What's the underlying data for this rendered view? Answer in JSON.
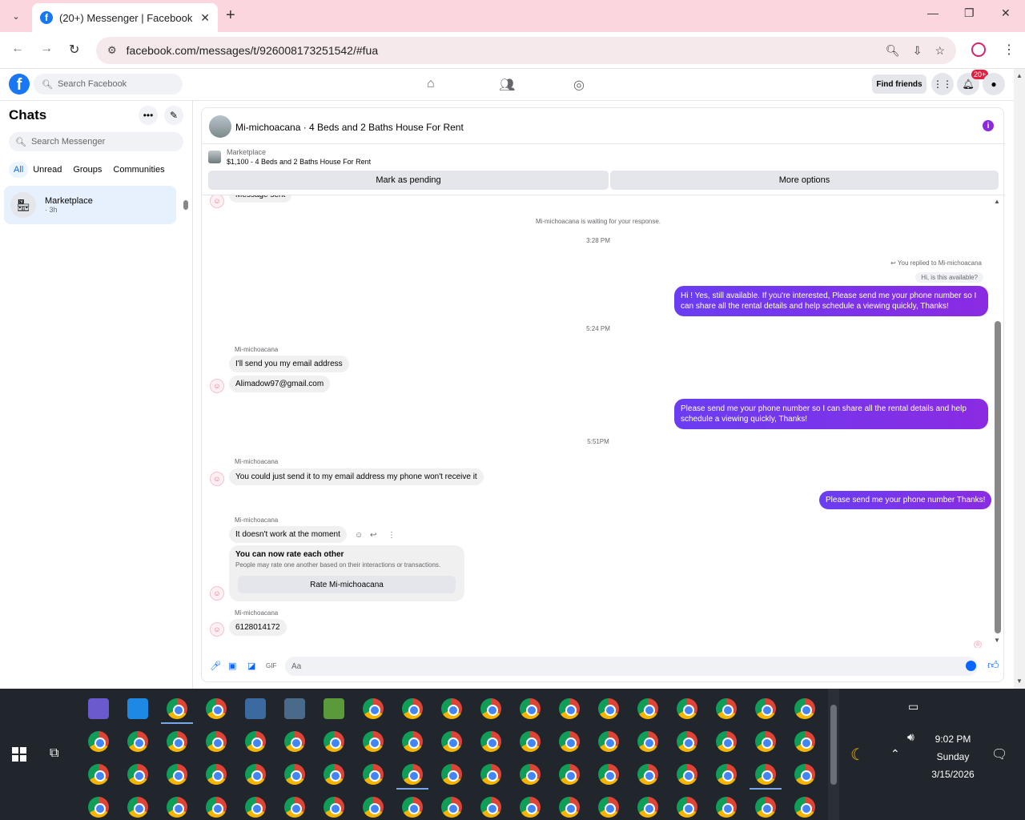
{
  "browser": {
    "tab_title": "(20+) Messenger | Facebook",
    "url": "facebook.com/messages/t/926008173251542/#fua"
  },
  "header": {
    "search_placeholder": "Search Facebook",
    "find_friends": "Find friends",
    "notification_count": "20+"
  },
  "sidebar": {
    "title": "Chats",
    "search_placeholder": "Search Messenger",
    "filters": [
      "All",
      "Unread",
      "Groups",
      "Communities"
    ],
    "chat": {
      "name": "Marketplace",
      "time": "· 3h"
    }
  },
  "conversation": {
    "title": "Mi-michoacana · 4 Beds and 2 Baths House For Rent",
    "marketplace_label": "Marketplace",
    "listing": "$1,100 - 4 Beds and 2 Baths House For Rent",
    "mark_pending": "Mark as pending",
    "more_options": "More options",
    "partial_top": "Message sent",
    "waiting_note": "Mi-michoacana is waiting for your response.",
    "time1": "3:28 PM",
    "reply_note": "You replied to Mi-michoacana",
    "reply_quote": "Hi, is this available?",
    "out1": "Hi ! Yes, still available. If you're interested, Please send me your phone number so I can share all the rental details and help schedule a viewing quickly, Thanks!",
    "time2": "5:24 PM",
    "sender": "Mi-michoacana",
    "in1": "I'll send you my email address",
    "in2": "Alimadow97@gmail.com",
    "out2": "Please send me your phone number so I can share all the rental details and help schedule a viewing quickly, Thanks!",
    "time3": "5:51PM",
    "in3": "You could just send it to my email address my phone won't receive it",
    "out3": "Please send me your phone number Thanks!",
    "in4": "It doesn't work at the moment",
    "rate_title": "You can now rate each other",
    "rate_sub": "People may rate one another based on their interactions or transactions.",
    "rate_btn": "Rate Mi-michoacana",
    "in5": "6128014172",
    "composer_placeholder": "Aa"
  },
  "taskbar": {
    "time": "9:02 PM",
    "day": "Sunday",
    "date": "3/15/2026"
  }
}
